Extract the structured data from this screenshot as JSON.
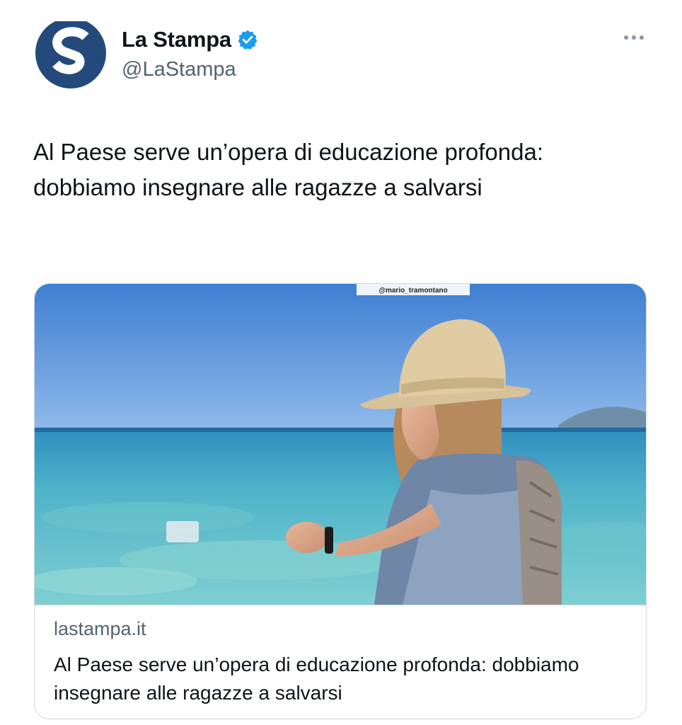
{
  "account": {
    "display_name": "La Stampa",
    "handle": "@LaStampa",
    "avatar_icon": "la-stampa-logo-icon",
    "verified_icon": "verified-badge-icon",
    "verified_color": "#1d9bf0",
    "avatar_color": "#244a7c"
  },
  "tweet": {
    "text": "Al Paese serve un’opera di educazione profonda: dobbiamo insegnare alle ragazze a salvarsi",
    "more_icon": "more-options-icon"
  },
  "link_card": {
    "image_watermark": "@mario_tramontano",
    "domain": "lastampa.it",
    "title": "Al Paese serve un’opera di educazione profonda: dobbiamo insegnare alle ragazze a salvarsi"
  }
}
